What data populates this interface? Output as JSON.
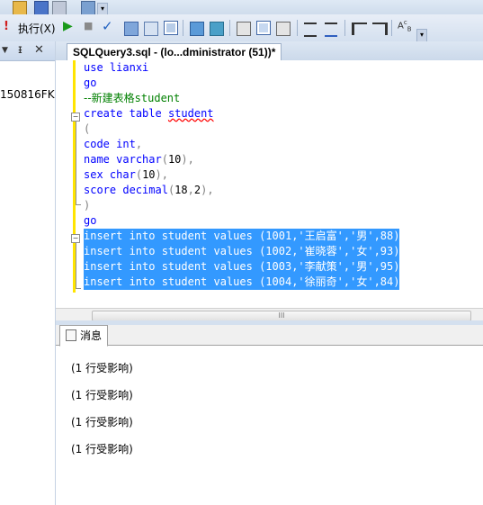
{
  "toolbar": {
    "execute_label": "执行(X)"
  },
  "left_pane": {
    "items": [
      "150816FK"
    ]
  },
  "editor": {
    "tab_title": "SQLQuery3.sql - (lo...dministrator (51))*",
    "lines": {
      "l1": [
        "use",
        "lianxi"
      ],
      "l2": [
        "go"
      ],
      "l3": [
        "--新建表格",
        "student"
      ],
      "l4": [
        "create",
        "table",
        "student"
      ],
      "l5": [
        "("
      ],
      "l6": [
        "code",
        "int",
        ","
      ],
      "l7": [
        "name",
        "varchar",
        "(",
        "10",
        "),"
      ],
      "l8": [
        "sex",
        "char",
        "(",
        "10",
        "),"
      ],
      "l9": [
        "score",
        "decimal",
        "(",
        "18",
        ",",
        "2",
        "),"
      ],
      "l10": [
        ")"
      ],
      "l11": [
        "go"
      ]
    },
    "inserts": [
      {
        "prefix": "insert into student values (1001,",
        "name": "'王启富'",
        "comma": ",",
        "gender": "'男'",
        "tail": ",88)"
      },
      {
        "prefix": "insert into student values (1002,",
        "name": "'崔晓蓉'",
        "comma": ",",
        "gender": "'女'",
        "tail": ",93)"
      },
      {
        "prefix": "insert into student values (1003,",
        "name": "'李献策'",
        "comma": ",",
        "gender": "'男'",
        "tail": ",95)"
      },
      {
        "prefix": "insert into student values (1004,",
        "name": "'徐丽奇'",
        "comma": ",",
        "gender": "'女'",
        "tail": ",84)"
      }
    ],
    "scroll_thumb": "III"
  },
  "results": {
    "tab_label": "消息",
    "messages": [
      "(1 行受影响)",
      "(1 行受影响)",
      "(1 行受影响)",
      "(1 行受影响)"
    ]
  }
}
